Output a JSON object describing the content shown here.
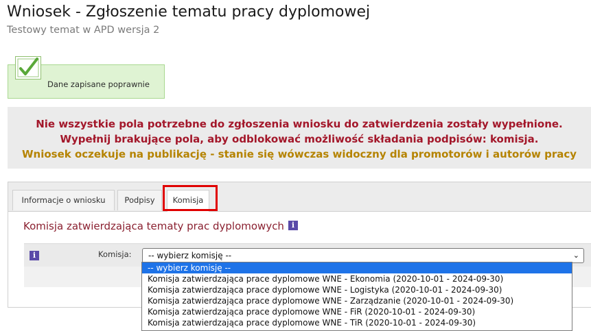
{
  "header": {
    "title": "Wniosek - Zgłoszenie tematu pracy dyplomowej",
    "subtitle": "Testowy temat w APD wersja 2"
  },
  "notice": {
    "success_message": "Dane zapisane poprawnie",
    "warning_line1": "Nie wszystkie pola potrzebne do zgłoszenia wniosku do zatwierdzenia zostały wypełnione.",
    "warning_line2": "Wypełnij brakujące pola, aby odblokować możliwość składania podpisów: komisja.",
    "warning_line3": "Wniosek oczekuje na publikację - stanie się wówczas widoczny dla promotorów i autorów pracy"
  },
  "tabs": [
    {
      "label": "Informacje o wniosku"
    },
    {
      "label": "Podpisy"
    },
    {
      "label": "Komisja"
    }
  ],
  "active_tab": "Komisja",
  "section": {
    "title": "Komisja zatwierdzająca tematy prac dyplomowych",
    "info_icon_glyph": "i"
  },
  "form": {
    "info_icon_glyph": "i",
    "label": "Komisja:",
    "selected_value": "-- wybierz komisję --",
    "chevron": "⌄"
  },
  "dropdown": {
    "options": [
      "-- wybierz komisję --",
      "Komisja zatwierdzająca prace dyplomowe WNE - Ekonomia (2020-10-01 - 2024-09-30)",
      "Komisja zatwierdzająca prace dyplomowe WNE - Logistyka (2020-10-01 - 2024-09-30)",
      "Komisja zatwierdzająca prace dyplomowe WNE - Zarządzanie (2020-10-01 - 2024-09-30)",
      "Komisja zatwierdzająca prace dyplomowe WNE - FiR (2020-10-01 - 2024-09-30)",
      "Komisja zatwierdzająca prace dyplomowe WNE - TiR (2020-10-01 - 2024-09-30)"
    ],
    "highlighted_index": 0
  },
  "colors": {
    "warning_red": "#a3172a",
    "warning_amber": "#b58300",
    "section_title": "#8a2030",
    "info_icon": "#5a4aa8",
    "success_bg": "#dff3d3",
    "highlight_outline": "#e00000",
    "dropdown_selected": "#1e73e8"
  }
}
